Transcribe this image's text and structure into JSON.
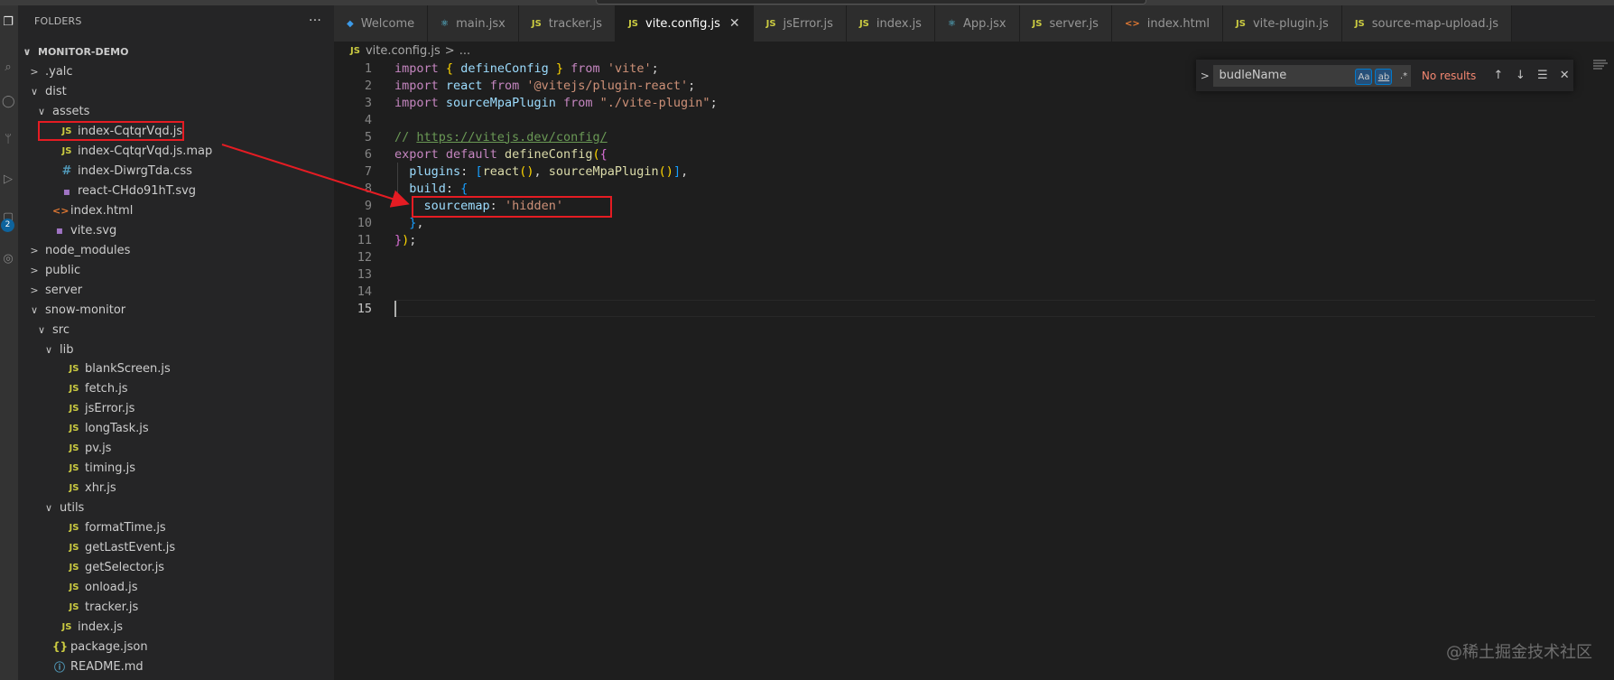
{
  "sidebar": {
    "title": "FOLDERS",
    "more": "···",
    "tree": [
      {
        "label": "MONITOR-DEMO",
        "twisty": "∨",
        "icon": "",
        "type": "root"
      },
      {
        "label": ".yalc",
        "twisty": ">",
        "icon": "",
        "type": "folder"
      },
      {
        "label": "dist",
        "twisty": "∨",
        "icon": "",
        "type": "folder"
      },
      {
        "label": "assets",
        "twisty": "∨",
        "icon": "",
        "type": "folder"
      },
      {
        "label": "index-CqtqrVqd.js",
        "twisty": "",
        "icon": "JS",
        "type": "js"
      },
      {
        "label": "index-CqtqrVqd.js.map",
        "twisty": "",
        "icon": "JS",
        "type": "js"
      },
      {
        "label": "index-DiwrgTda.css",
        "twisty": "",
        "icon": "#",
        "type": "css"
      },
      {
        "label": "react-CHdo91hT.svg",
        "twisty": "",
        "icon": "▪",
        "type": "svg"
      },
      {
        "label": "index.html",
        "twisty": "",
        "icon": "<>",
        "type": "html"
      },
      {
        "label": "vite.svg",
        "twisty": "",
        "icon": "▪",
        "type": "svg"
      },
      {
        "label": "node_modules",
        "twisty": ">",
        "icon": "",
        "type": "folder"
      },
      {
        "label": "public",
        "twisty": ">",
        "icon": "",
        "type": "folder"
      },
      {
        "label": "server",
        "twisty": ">",
        "icon": "",
        "type": "folder"
      },
      {
        "label": "snow-monitor",
        "twisty": "∨",
        "icon": "",
        "type": "folder"
      },
      {
        "label": "src",
        "twisty": "∨",
        "icon": "",
        "type": "folder"
      },
      {
        "label": "lib",
        "twisty": "∨",
        "icon": "",
        "type": "folder"
      },
      {
        "label": "blankScreen.js",
        "twisty": "",
        "icon": "JS",
        "type": "js"
      },
      {
        "label": "fetch.js",
        "twisty": "",
        "icon": "JS",
        "type": "js"
      },
      {
        "label": "jsError.js",
        "twisty": "",
        "icon": "JS",
        "type": "js"
      },
      {
        "label": "longTask.js",
        "twisty": "",
        "icon": "JS",
        "type": "js"
      },
      {
        "label": "pv.js",
        "twisty": "",
        "icon": "JS",
        "type": "js"
      },
      {
        "label": "timing.js",
        "twisty": "",
        "icon": "JS",
        "type": "js"
      },
      {
        "label": "xhr.js",
        "twisty": "",
        "icon": "JS",
        "type": "js"
      },
      {
        "label": "utils",
        "twisty": "∨",
        "icon": "",
        "type": "folder"
      },
      {
        "label": "formatTime.js",
        "twisty": "",
        "icon": "JS",
        "type": "js"
      },
      {
        "label": "getLastEvent.js",
        "twisty": "",
        "icon": "JS",
        "type": "js"
      },
      {
        "label": "getSelector.js",
        "twisty": "",
        "icon": "JS",
        "type": "js"
      },
      {
        "label": "onload.js",
        "twisty": "",
        "icon": "JS",
        "type": "js"
      },
      {
        "label": "tracker.js",
        "twisty": "",
        "icon": "JS",
        "type": "js"
      },
      {
        "label": "index.js",
        "twisty": "",
        "icon": "JS",
        "type": "js"
      },
      {
        "label": "package.json",
        "twisty": "",
        "icon": "{}",
        "type": "json"
      },
      {
        "label": "README.md",
        "twisty": "",
        "icon": "ⓘ",
        "type": "md"
      }
    ]
  },
  "activity": {
    "badge": "2"
  },
  "tabs": [
    {
      "label": "Welcome",
      "icon": "◆",
      "active": false
    },
    {
      "label": "main.jsx",
      "icon": "⚛",
      "active": false
    },
    {
      "label": "tracker.js",
      "icon": "JS",
      "active": false
    },
    {
      "label": "vite.config.js",
      "icon": "JS",
      "active": true
    },
    {
      "label": "jsError.js",
      "icon": "JS",
      "active": false
    },
    {
      "label": "index.js",
      "icon": "JS",
      "active": false
    },
    {
      "label": "App.jsx",
      "icon": "⚛",
      "active": false
    },
    {
      "label": "server.js",
      "icon": "JS",
      "active": false
    },
    {
      "label": "index.html",
      "icon": "<>",
      "active": false
    },
    {
      "label": "vite-plugin.js",
      "icon": "JS",
      "active": false
    },
    {
      "label": "source-map-upload.js",
      "icon": "JS",
      "active": false
    }
  ],
  "breadcrumb": {
    "icon": "JS",
    "file": "vite.config.js",
    "sep": ">",
    "rest": "..."
  },
  "editor": {
    "line_numbers": [
      "1",
      "2",
      "3",
      "4",
      "5",
      "6",
      "7",
      "8",
      "9",
      "10",
      "11",
      "12",
      "13",
      "14",
      "15"
    ],
    "current_line": "15"
  },
  "find": {
    "query": "budleName",
    "match_case": "Aa",
    "whole_word": "ab",
    "regex": ".*",
    "result": "No results"
  },
  "watermark": "@稀土掘金技术社区",
  "colors": {
    "highlight_box": "#e51c23",
    "accent": "#007acc"
  }
}
